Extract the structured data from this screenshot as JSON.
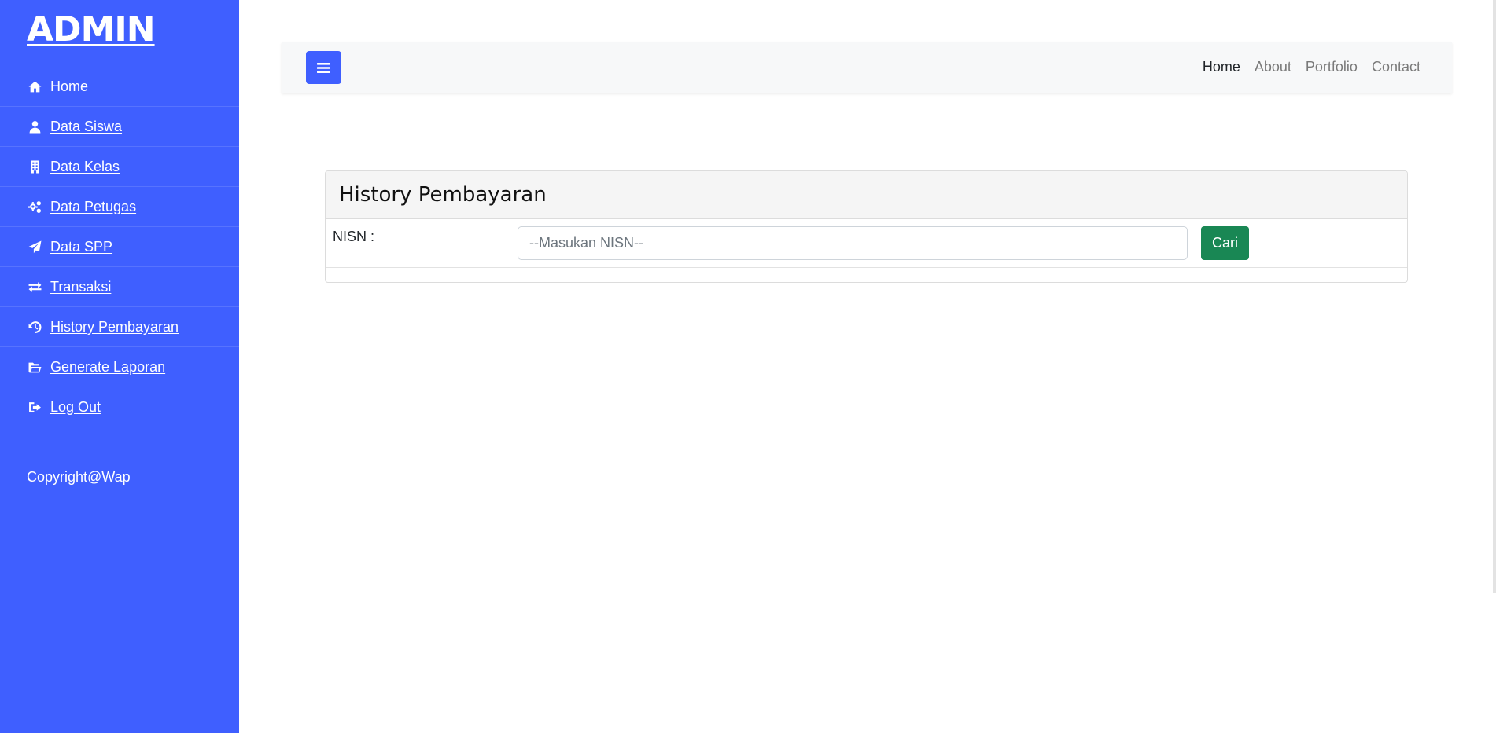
{
  "sidebar": {
    "brand": "ADMIN",
    "items": [
      {
        "label": " Home",
        "icon": "home-icon"
      },
      {
        "label": " Data Siswa",
        "icon": "user-icon"
      },
      {
        "label": " Data Kelas",
        "icon": "building-icon"
      },
      {
        "label": " Data Petugas",
        "icon": "cogs-icon"
      },
      {
        "label": " Data SPP",
        "icon": "paper-plane-icon"
      },
      {
        "label": " Transaksi",
        "icon": "exchange-icon"
      },
      {
        "label": "History Pembayaran",
        "icon": "history-icon"
      },
      {
        "label": " Generate Laporan",
        "icon": "folder-open-icon"
      },
      {
        "label": " Log Out",
        "icon": "sign-out-icon"
      }
    ],
    "copyright": "Copyright@Wap"
  },
  "topbar": {
    "toggle_icon": "bars-icon",
    "links": [
      "Home",
      "About",
      "Portfolio",
      "Contact"
    ],
    "active_link": "Home"
  },
  "main": {
    "card_title": "History Pembayaran",
    "nisn_label": "NISN :",
    "nisn_placeholder": "--Masukan NISN--",
    "nisn_value": "",
    "search_button": "Cari"
  },
  "colors": {
    "sidebar_bg": "#3f5fff",
    "accent": "#3f5fff",
    "button_success": "#198754"
  }
}
